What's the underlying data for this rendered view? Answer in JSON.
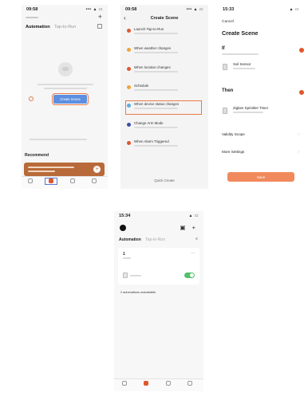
{
  "colors": {
    "accent_orange": "#e0572d",
    "button_blue": "#5d8fe0",
    "recommend_card": "#b86a3a",
    "toggle_on": "#55c06a",
    "save_button": "#f08a5d",
    "highlight_box": "#e87a4a"
  },
  "screen1": {
    "time": "09:58",
    "status_icons": "••• ▲ ▭",
    "home_label": "",
    "plus_icon": "+",
    "tabs": [
      "Automation",
      "Tap-to-Run"
    ],
    "create_button": "Create Scene",
    "unavailable_text": "",
    "recommend_title": "Recommend",
    "recommend_card": "",
    "recommend_plus": "+",
    "tabbar": [
      "",
      "",
      "",
      ""
    ]
  },
  "screen2": {
    "time": "09:58",
    "status_icons": "••• ▲ ▭",
    "back_icon": "‹",
    "title": "Create Scene",
    "items": [
      {
        "label": "Launch Tap-to-Run",
        "color": "#e0572d"
      },
      {
        "label": "When weather changes",
        "color": "#f2a33a"
      },
      {
        "label": "When location changes",
        "color": "#e0572d"
      },
      {
        "label": "Schedule",
        "color": "#f2a33a"
      },
      {
        "label": "When device status changes",
        "color": "#5aaedf"
      },
      {
        "label": "Change Arm Mode",
        "color": "#3a4fa8"
      },
      {
        "label": "When Alarm Triggered",
        "color": "#e0572d"
      }
    ],
    "quick_create": "Quick Create"
  },
  "screen3": {
    "time": "15:33",
    "status_icons": "▲ ▭",
    "cancel": "Cancel",
    "title": "Create Scene",
    "if_label": "If",
    "condition_label": "Soil Sensor",
    "then_label": "Then",
    "action_label": "Zigbee Sprinkler Timer",
    "validity_label": "Validity Scope",
    "more_settings_label": "More Settings",
    "chevron": "›",
    "save_button": "Save"
  },
  "screen4": {
    "time": "15:34",
    "status_icons": "▲ ▭",
    "top_icons": "▣ +",
    "tabs": [
      "Automation",
      "Tap-to-Run"
    ],
    "list_icon": "≡",
    "card_number": "1",
    "more_icon": "…",
    "toggle_on": true,
    "unavailable_text": "2 automations unavailable",
    "tabbar": [
      "",
      "",
      "",
      ""
    ]
  }
}
